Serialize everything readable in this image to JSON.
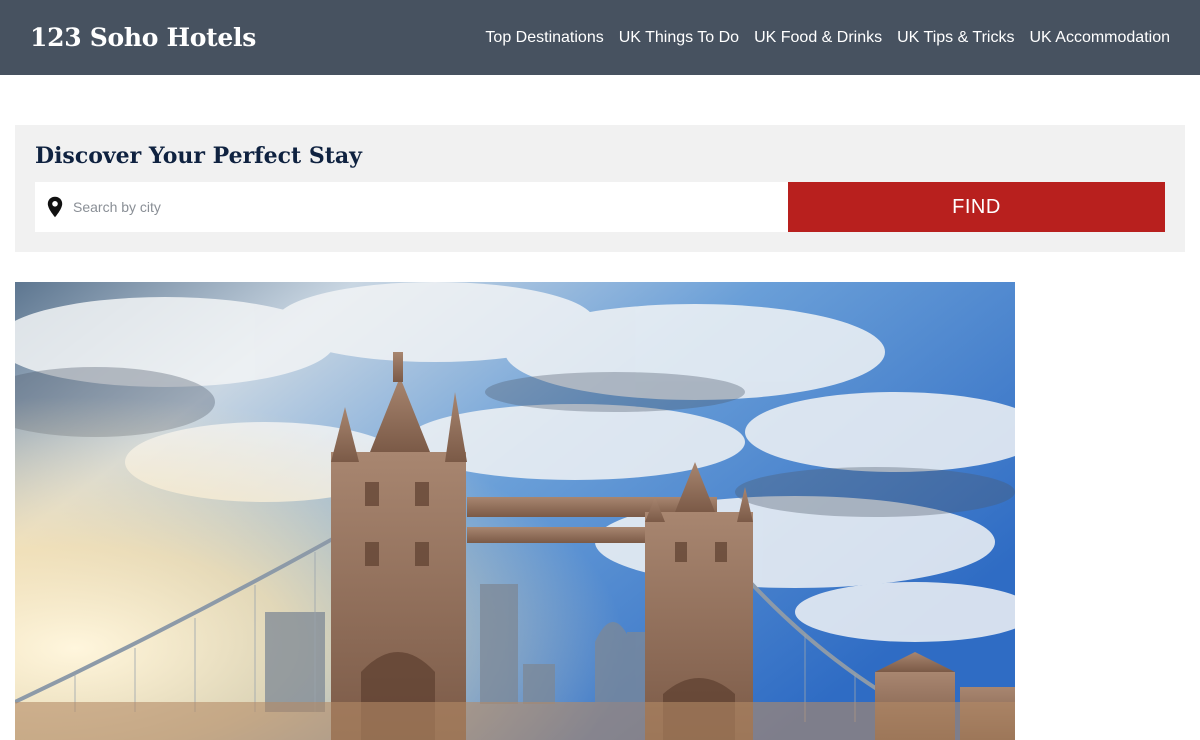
{
  "header": {
    "brand": "123 Soho Hotels",
    "nav": [
      "Top Destinations",
      "UK Things To Do",
      "UK Food & Drinks",
      "UK Tips & Tricks",
      "UK Accommodation"
    ]
  },
  "search": {
    "title": "Discover Your Perfect Stay",
    "placeholder": "Search by city",
    "value": "",
    "button_label": "FIND",
    "pin_icon": "map-pin-icon"
  },
  "hero": {
    "image": "tower-bridge-london-photo"
  },
  "colors": {
    "header_bg": "#475260",
    "panel_bg": "#f1f1f1",
    "accent": "#b8201e",
    "title": "#0f2240"
  }
}
